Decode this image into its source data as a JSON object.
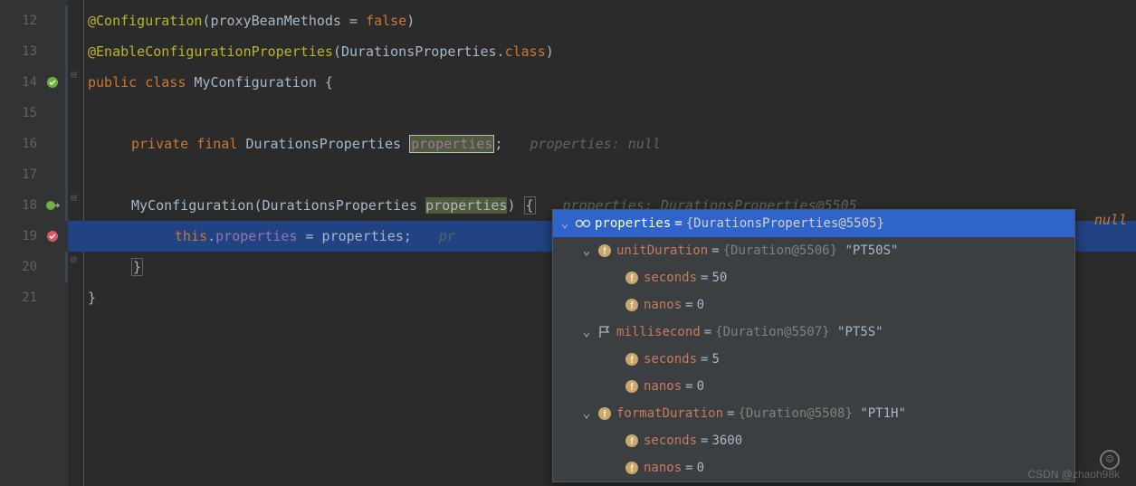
{
  "lines": {
    "12": "12",
    "13": "13",
    "14": "14",
    "15": "15",
    "16": "16",
    "17": "17",
    "18": "18",
    "19": "19",
    "20": "20",
    "21": "21"
  },
  "code": {
    "l12_anno": "@Configuration",
    "l12_p1": "(proxyBeanMethods = ",
    "l12_false": "false",
    "l12_p2": ")",
    "l13_anno": "@EnableConfigurationProperties",
    "l13_p1": "(DurationsProperties.",
    "l13_cls": "class",
    "l13_p2": ")",
    "l14_pub": "public ",
    "l14_cls": "class ",
    "l14_name": "MyConfiguration {",
    "l16_priv": "private ",
    "l16_final": "final ",
    "l16_type": "DurationsProperties ",
    "l16_field": "properties",
    "l16_semi": ";",
    "l16_inlay": "properties: null",
    "l18_name": "MyConfiguration",
    "l18_p1": "(DurationsProperties ",
    "l18_param": "properties",
    "l18_p2": ") ",
    "l18_brace": "{",
    "l18_inlay": "properties: DurationsProperties@5505",
    "l19_this": "this",
    "l19_dot": ".",
    "l19_field": "properties",
    "l19_eq": " = properties;",
    "l19_inlay": "pr",
    "l20_brace": "}",
    "l21_brace": "}"
  },
  "debug": {
    "root_name": "properties",
    "root_val": "{DurationsProperties@5505}",
    "null_suffix": "null",
    "items": [
      {
        "name": "unitDuration",
        "type": "{Duration@5506}",
        "val": "\"PT50S\"",
        "children": [
          {
            "name": "seconds",
            "val": "50"
          },
          {
            "name": "nanos",
            "val": "0"
          }
        ]
      },
      {
        "name": "millisecond",
        "type": "{Duration@5507}",
        "val": "\"PT5S\"",
        "flag": true,
        "children": [
          {
            "name": "seconds",
            "val": "5"
          },
          {
            "name": "nanos",
            "val": "0"
          }
        ]
      },
      {
        "name": "formatDuration",
        "type": "{Duration@5508}",
        "val": "\"PT1H\"",
        "children": [
          {
            "name": "seconds",
            "val": "3600"
          },
          {
            "name": "nanos",
            "val": "0"
          }
        ]
      }
    ]
  },
  "watermark": "CSDN @zhaoh98k"
}
